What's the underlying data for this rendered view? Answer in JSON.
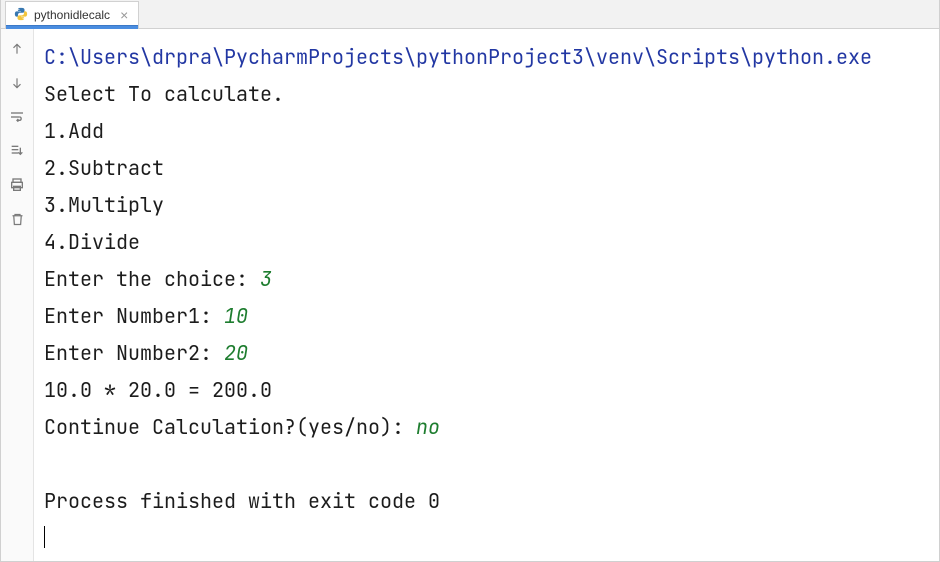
{
  "tab": {
    "title": "pythonidlecalc",
    "active": true
  },
  "icons": {
    "python": "python-file-icon",
    "close": "close-icon",
    "up": "scroll-up-icon",
    "down": "scroll-down-icon",
    "wrap": "soft-wrap-icon",
    "scroll_end": "scroll-to-end-icon",
    "print": "print-icon",
    "trash": "clear-icon"
  },
  "console": {
    "path": "C:\\Users\\drpra\\PycharmProjects\\pythonProject3\\venv\\Scripts\\python.exe",
    "lines": {
      "prompt_select": "Select To calculate.",
      "opt1": "1.Add",
      "opt2": "2.Subtract",
      "opt3": "3.Multiply",
      "opt4": "4.Divide",
      "choice_prompt": "Enter the choice: ",
      "choice_value": "3",
      "num1_prompt": "Enter Number1: ",
      "num1_value": "10",
      "num2_prompt": "Enter Number2: ",
      "num2_value": "20",
      "result": "10.0 * 20.0 = 200.0",
      "cont_prompt": "Continue Calculation?(yes/no): ",
      "cont_value": "no",
      "blank": "",
      "exit": "Process finished with exit code 0"
    }
  }
}
